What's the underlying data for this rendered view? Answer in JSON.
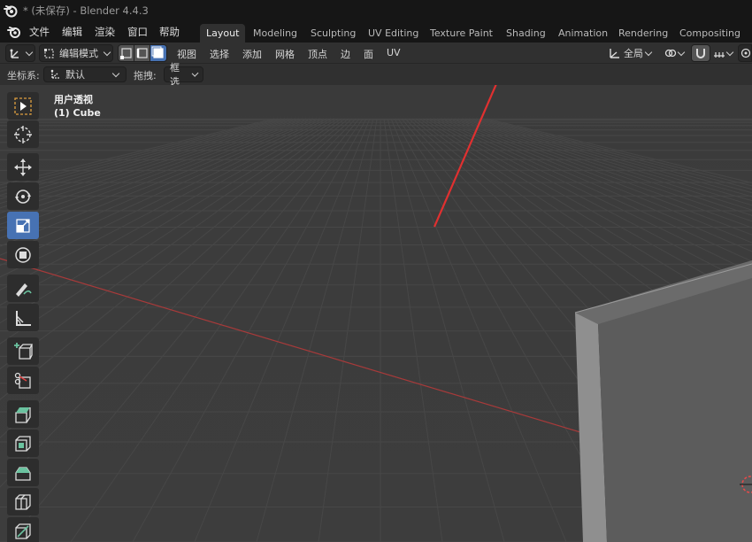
{
  "window": {
    "title": "* (未保存) - Blender 4.4.3"
  },
  "menu": {
    "items": [
      "文件",
      "编辑",
      "渲染",
      "窗口",
      "帮助"
    ]
  },
  "workspaces": {
    "tabs": [
      "Layout",
      "Modeling",
      "Sculpting",
      "UV Editing",
      "Texture Paint",
      "Shading",
      "Animation",
      "Rendering",
      "Compositing"
    ],
    "active": "Layout"
  },
  "header": {
    "mode": "编辑模式",
    "menus": [
      "视图",
      "选择",
      "添加",
      "网格",
      "顶点",
      "边",
      "面",
      "UV"
    ],
    "orientation": "全局"
  },
  "tool_settings": {
    "coord_label": "坐标系:",
    "coord_value": "默认",
    "drag_label": "拖拽:",
    "drag_value": "框选"
  },
  "viewport": {
    "view_name": "用户透视",
    "object_label": "(1) Cube"
  },
  "tools": [
    "select-box-icon",
    "cursor-icon",
    "move-icon",
    "rotate-icon",
    "scale-icon",
    "transform-icon",
    "annotate-icon",
    "measure-icon",
    "add-cube-icon",
    "cut-icon",
    "extrude-icon",
    "inset-icon",
    "bevel-icon",
    "loop-cut-icon",
    "knife-icon"
  ],
  "colors": {
    "accent": "#4772b3",
    "arrow": "#e03030",
    "x_axis": "#a83a3a"
  }
}
